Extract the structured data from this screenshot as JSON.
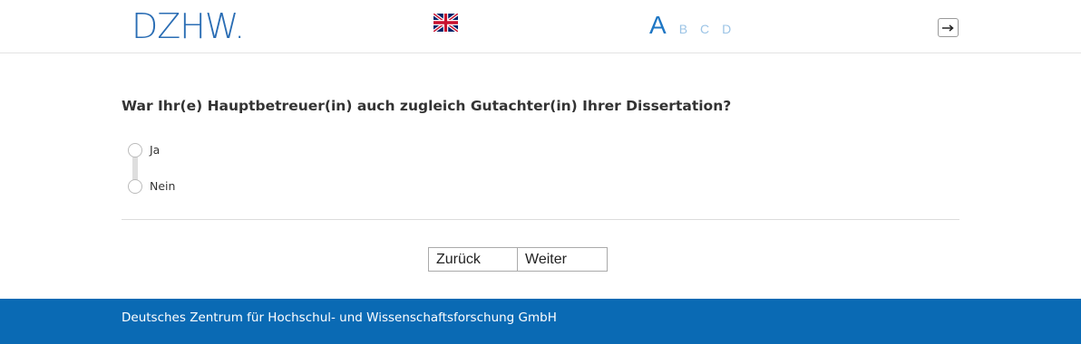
{
  "header": {
    "logo_text": "DZHW.",
    "language_flag": "uk-flag-icon",
    "steps": [
      {
        "label": "A",
        "active": true
      },
      {
        "label": "B",
        "active": false
      },
      {
        "label": "C",
        "active": false
      },
      {
        "label": "D",
        "active": false
      }
    ],
    "logout_icon": "logout-icon"
  },
  "question": {
    "text": "War Ihr(e) Hauptbetreuer(in) auch zugleich Gutachter(in) Ihrer Dissertation?",
    "options": [
      {
        "label": "Ja",
        "selected": false
      },
      {
        "label": "Nein",
        "selected": false
      }
    ]
  },
  "navigation": {
    "back_label": "Zurück",
    "next_label": "Weiter"
  },
  "footer": {
    "text": "Deutsches Zentrum für Hochschul- und Wissenschaftsforschung GmbH"
  },
  "colors": {
    "brand_blue": "#0a6ab4",
    "step_active": "#1f77c4",
    "step_inactive": "#9cc4e6"
  }
}
